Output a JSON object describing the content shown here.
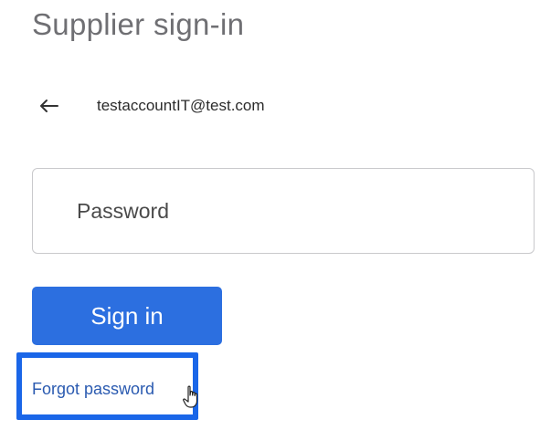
{
  "page": {
    "title": "Supplier sign-in"
  },
  "account": {
    "back_icon": "arrow-left-icon",
    "email": "testaccountIT@test.com"
  },
  "password": {
    "placeholder": "Password",
    "value": ""
  },
  "actions": {
    "sign_in_label": "Sign in",
    "forgot_password_label": "Forgot password"
  },
  "colors": {
    "primary_button": "#2c6fe0",
    "highlight_border": "#1a66e8",
    "link": "#2a5ab0",
    "title_text": "#6f6f73"
  },
  "cursor": {
    "icon": "hand-pointer-icon"
  }
}
